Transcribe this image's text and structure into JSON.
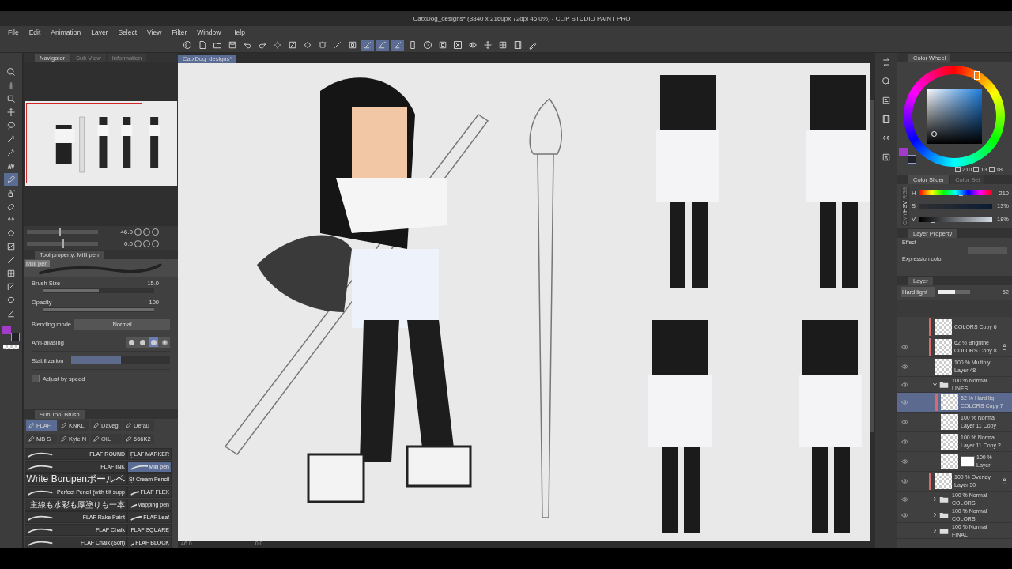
{
  "window": {
    "title": "CatxDog_designs* (3840 x 2160px 72dpi 46.0%) - CLIP STUDIO PAINT PRO"
  },
  "menu": [
    "File",
    "Edit",
    "Animation",
    "Layer",
    "Select",
    "View",
    "Filter",
    "Window",
    "Help"
  ],
  "toolbar": [
    {
      "kind": "app",
      "selected": false
    },
    {
      "kind": "file",
      "selected": false
    },
    {
      "kind": "folder",
      "selected": false
    },
    {
      "kind": "save",
      "selected": false
    },
    {
      "kind": "undo",
      "selected": false
    },
    {
      "kind": "redo",
      "selected": false
    },
    {
      "kind": "spinner",
      "selected": false
    },
    {
      "kind": "clear",
      "selected": false
    },
    {
      "kind": "fill",
      "selected": false
    },
    {
      "kind": "transform",
      "selected": false
    },
    {
      "kind": "line",
      "selected": false
    },
    {
      "kind": "frame",
      "selected": false
    },
    {
      "kind": "snap",
      "selected": true
    },
    {
      "kind": "curve",
      "selected": true
    },
    {
      "kind": "snap",
      "selected": true
    },
    {
      "kind": "device",
      "selected": false
    },
    {
      "kind": "help",
      "selected": false
    },
    {
      "kind": "frame",
      "selected": false
    },
    {
      "kind": "fit",
      "selected": false
    },
    {
      "kind": "flip",
      "selected": false
    },
    {
      "kind": "move",
      "selected": false
    },
    {
      "kind": "grid",
      "selected": false
    },
    {
      "kind": "film",
      "selected": false
    },
    {
      "kind": "pencil",
      "selected": false
    }
  ],
  "tools": [
    {
      "kind": "search",
      "selected": false
    },
    {
      "kind": "hand",
      "selected": false
    },
    {
      "kind": "select",
      "selected": false
    },
    {
      "kind": "move",
      "selected": false
    },
    {
      "kind": "lasso",
      "selected": false
    },
    {
      "kind": "wand",
      "selected": false
    },
    {
      "kind": "eyedropper",
      "selected": false
    },
    {
      "kind": "grass",
      "selected": false
    },
    {
      "kind": "pen",
      "selected": true
    },
    {
      "kind": "spray",
      "selected": false
    },
    {
      "kind": "eraser",
      "selected": false
    },
    {
      "kind": "drops",
      "selected": false
    },
    {
      "kind": "fill",
      "selected": false
    },
    {
      "kind": "gradient",
      "selected": false
    },
    {
      "kind": "line",
      "selected": false
    },
    {
      "kind": "grid",
      "selected": false
    },
    {
      "kind": "ruler",
      "selected": false
    },
    {
      "kind": "balloon",
      "selected": false
    },
    {
      "kind": "correct",
      "selected": false
    }
  ],
  "navigator": {
    "tabs": [
      {
        "label": "Navigator",
        "selected": true
      },
      {
        "label": "Sub View",
        "selected": false
      },
      {
        "label": "Information",
        "selected": false
      }
    ],
    "zoom": "46.0",
    "zoom_slider": {
      "level": 0.45
    },
    "rotation": "0.0",
    "rotation_slider": {
      "level": 0.5
    }
  },
  "tool_property": {
    "title": "Tool property: Milli pen",
    "preset": "Milli pen",
    "rows": [
      {
        "kind": "slider",
        "label": "Brush Size",
        "value": "15.0",
        "level": 0.5
      },
      {
        "kind": "slider",
        "label": "Opacity",
        "value": "100",
        "level": 1
      },
      {
        "kind": "dropdown",
        "label": "Blending mode",
        "value": "Normal"
      },
      {
        "kind": "options",
        "label": "Anti-aliasing",
        "options": [
          {
            "selected": false
          },
          {
            "selected": false
          },
          {
            "selected": true
          },
          {
            "selected": false
          }
        ]
      },
      {
        "kind": "segments",
        "label": "Stabilization",
        "level": 0.5
      }
    ],
    "adjust_by_speed": {
      "label": "Adjust by speed",
      "checked": false
    }
  },
  "sub_tool": {
    "title": "Sub Tool Brush",
    "groups": [
      {
        "label": "FLAF",
        "selected": true
      },
      {
        "label": "KNKL",
        "selected": false
      },
      {
        "label": "Daveg",
        "selected": false
      },
      {
        "label": "Defau",
        "selected": false
      },
      {
        "label": "MB S",
        "selected": false
      },
      {
        "label": "Kyle N",
        "selected": false
      },
      {
        "label": "OIL",
        "selected": false
      },
      {
        "label": "666K2",
        "selected": false
      }
    ],
    "brushes": [
      {
        "label": "FLAF ROUND",
        "selected": false
      },
      {
        "label": "FLAF MARKER",
        "selected": false
      },
      {
        "label": "FLAF INK",
        "selected": false
      },
      {
        "label": "Milli pen",
        "selected": true
      },
      {
        "label": "Write Borupenボールペ",
        "selected": false
      },
      {
        "label": "St-Cream Pencil",
        "selected": false
      },
      {
        "label": "Perfect Pencil (with tilt supp",
        "selected": false
      },
      {
        "label": "FLAF FLEX",
        "selected": false
      },
      {
        "label": "主線も水彩も厚塗りも一本",
        "selected": false
      },
      {
        "label": "Mapping pen",
        "selected": false
      },
      {
        "label": "FLAF Rake Paint",
        "selected": false
      },
      {
        "label": "FLAF Leaf",
        "selected": false
      },
      {
        "label": "FLAF Chalk",
        "selected": false
      },
      {
        "label": "FLAF SQUARE",
        "selected": false
      },
      {
        "label": "FLAF Chalk (Soft)",
        "selected": false
      },
      {
        "label": "FLAF BLOCK",
        "selected": false
      }
    ]
  },
  "canvas": {
    "tab": "CatxDog_designs*",
    "zoom": "46.0",
    "rotation": "0.0"
  },
  "color_wheel": {
    "title": "Color Wheel",
    "h": "210",
    "s": "13",
    "v": "18"
  },
  "color_slider": {
    "tabs": [
      {
        "label": "Color Slider",
        "selected": true
      },
      {
        "label": "Color Set",
        "selected": false
      }
    ],
    "modes": [
      {
        "label": "RGB",
        "selected": false
      },
      {
        "label": "HSV",
        "selected": true
      },
      {
        "label": "CMY",
        "selected": false
      }
    ],
    "sliders": [
      {
        "label": "H",
        "value": "210",
        "level": 0.58
      },
      {
        "label": "S",
        "value": "13%",
        "level": 0.13
      },
      {
        "label": "V",
        "value": "18%",
        "level": 0.18
      }
    ]
  },
  "layer_property": {
    "title": "Layer Property",
    "effect": "Effect",
    "expression": "Expression color"
  },
  "layer_panel": {
    "title": "Layer",
    "blend_mode": "Hard light",
    "opacity": "52",
    "opacity_slider": {
      "level": 0.52
    },
    "layers": [
      {
        "kind": "layer",
        "name": "COLORS Copy 6",
        "visible": false,
        "selected": false,
        "locked": false,
        "color": "#d96a6a"
      },
      {
        "kind": "layer",
        "mode": "62 % Brightne",
        "name": "COLORS Copy 8",
        "visible": true,
        "selected": false,
        "locked": true,
        "color": "#d96a6a"
      },
      {
        "kind": "layer",
        "mode": "100 % Multiply",
        "name": "Layer 48",
        "visible": true,
        "selected": false,
        "locked": false
      },
      {
        "kind": "folder",
        "mode": "100 % Normal",
        "name": "LINES",
        "visible": true,
        "selected": false,
        "locked": false,
        "expanded": true,
        "children": [
          {
            "kind": "layer",
            "mode": "52 % Hard lig",
            "name": "COLORS Copy 7",
            "visible": true,
            "selected": true,
            "locked": false,
            "color": "#d96a6a"
          },
          {
            "kind": "layer",
            "mode": "100 % Normal",
            "name": "Layer 11 Copy",
            "visible": true,
            "selected": false,
            "locked": false
          },
          {
            "kind": "layer",
            "mode": "100 % Normal",
            "name": "Layer 11 Copy 2",
            "visible": true,
            "selected": false,
            "locked": false
          },
          {
            "kind": "mask",
            "mode": "100 %",
            "name": "Layer",
            "visible": true,
            "selected": false,
            "locked": false
          }
        ]
      },
      {
        "kind": "layer",
        "mode": "100 % Overlay",
        "name": "Layer 50",
        "visible": true,
        "selected": false,
        "locked": true,
        "color": "#d96a6a"
      },
      {
        "kind": "folder",
        "mode": "100 % Normal",
        "name": "COLORS",
        "visible": true,
        "selected": false,
        "locked": false,
        "expanded": false
      },
      {
        "kind": "folder",
        "mode": "100 % Normal",
        "name": "COLORS",
        "visible": true,
        "selected": false,
        "locked": false,
        "expanded": false
      },
      {
        "kind": "folder",
        "mode": "100 % Normal",
        "name": "FINAL",
        "visible": false,
        "selected": false,
        "locked": false,
        "expanded": false
      }
    ]
  }
}
